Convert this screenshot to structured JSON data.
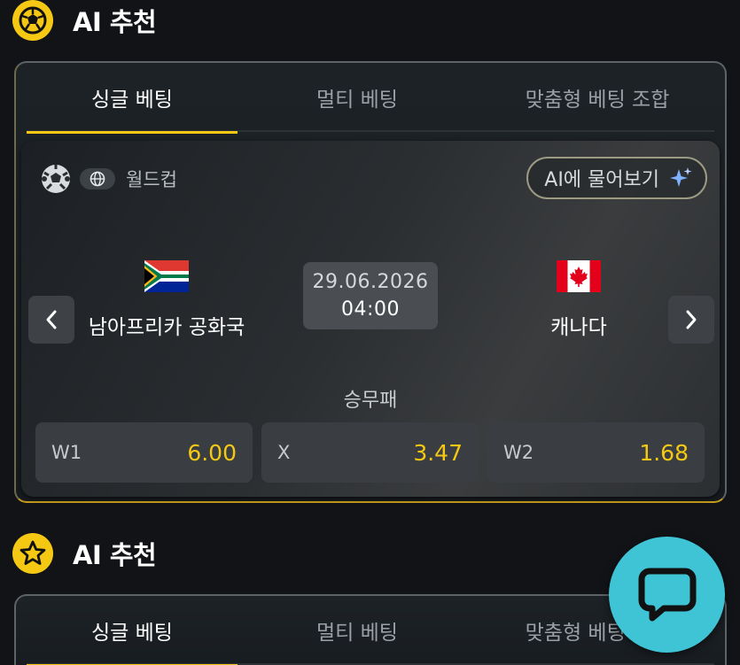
{
  "sections": [
    {
      "title": "AI 추천",
      "icon": "soccer-ball-icon",
      "tabs": [
        {
          "label": "싱글 베팅",
          "active": true
        },
        {
          "label": "멀티 베팅",
          "active": false
        },
        {
          "label": "맞춤형 베팅 조합",
          "active": false
        }
      ]
    },
    {
      "title": "AI 추천",
      "icon": "star-icon",
      "tabs": [
        {
          "label": "싱글 베팅",
          "active": true
        },
        {
          "label": "멀티 베팅",
          "active": false
        },
        {
          "label": "맞춤형 베팅 조합",
          "active": false
        }
      ]
    }
  ],
  "match": {
    "sport_icon": "soccer-ball-icon",
    "region_icon": "globe-icon",
    "league": "월드컵",
    "ask_ai_label": "AI에 물어보기",
    "home_team": {
      "name": "남아프리카 공화국",
      "flag": "south-africa-flag"
    },
    "away_team": {
      "name": "캐나다",
      "flag": "canada-flag"
    },
    "date": "29.06.2026",
    "time": "04:00",
    "market": "승무패",
    "odds": [
      {
        "label": "W1",
        "value": "6.00"
      },
      {
        "label": "X",
        "value": "3.47"
      },
      {
        "label": "W2",
        "value": "1.68"
      }
    ]
  },
  "colors": {
    "accent": "#f5c814",
    "background": "#111317",
    "chat_button": "#3fc4d6"
  }
}
